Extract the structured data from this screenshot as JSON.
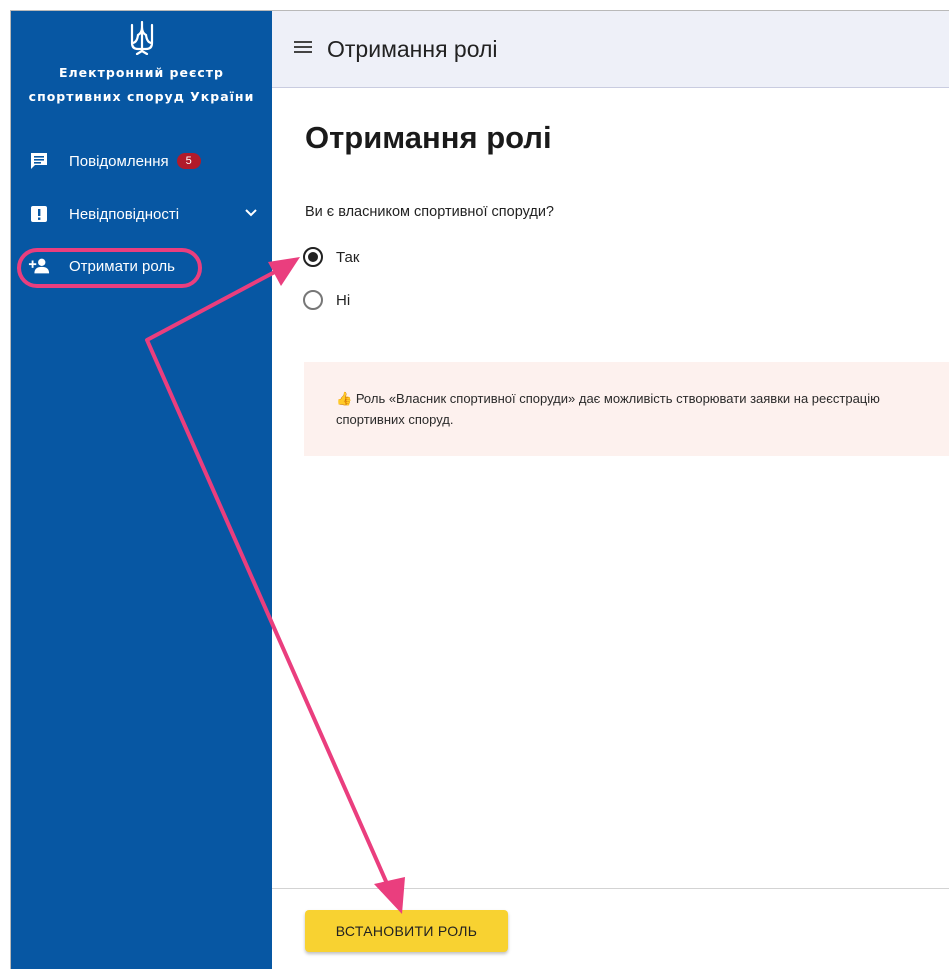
{
  "sidebar": {
    "brand_line1": "Електронний реєстр",
    "brand_line2": "спортивних споруд України",
    "items": [
      {
        "label": "Повідомлення",
        "icon": "message-icon",
        "badge": "5"
      },
      {
        "label": "Невідповідності",
        "icon": "warning-icon"
      },
      {
        "label": "Отримати роль",
        "icon": "add-person-icon"
      }
    ]
  },
  "topbar": {
    "title": "Отримання ролі",
    "icon": "hamburger-menu-icon"
  },
  "main": {
    "title": "Отримання ролі",
    "question": "Ви є власником спортивної споруди?",
    "options": [
      {
        "label": "Так",
        "selected": true
      },
      {
        "label": "Ні",
        "selected": false
      }
    ],
    "info_emoji": "👍",
    "info_text": "Роль «Власник спортивної споруди» дає можливість створювати заявки на реєстрацію спортивних споруд."
  },
  "footer": {
    "button_label": "ВСТАНОВИТИ РОЛЬ"
  },
  "colors": {
    "sidebar": "#0757a3",
    "badge": "#b11a2a",
    "button": "#f8d231",
    "annotation": "#ea3e7e",
    "info_bg": "#fdf1ee",
    "topbar_bg": "#eef0f8"
  }
}
